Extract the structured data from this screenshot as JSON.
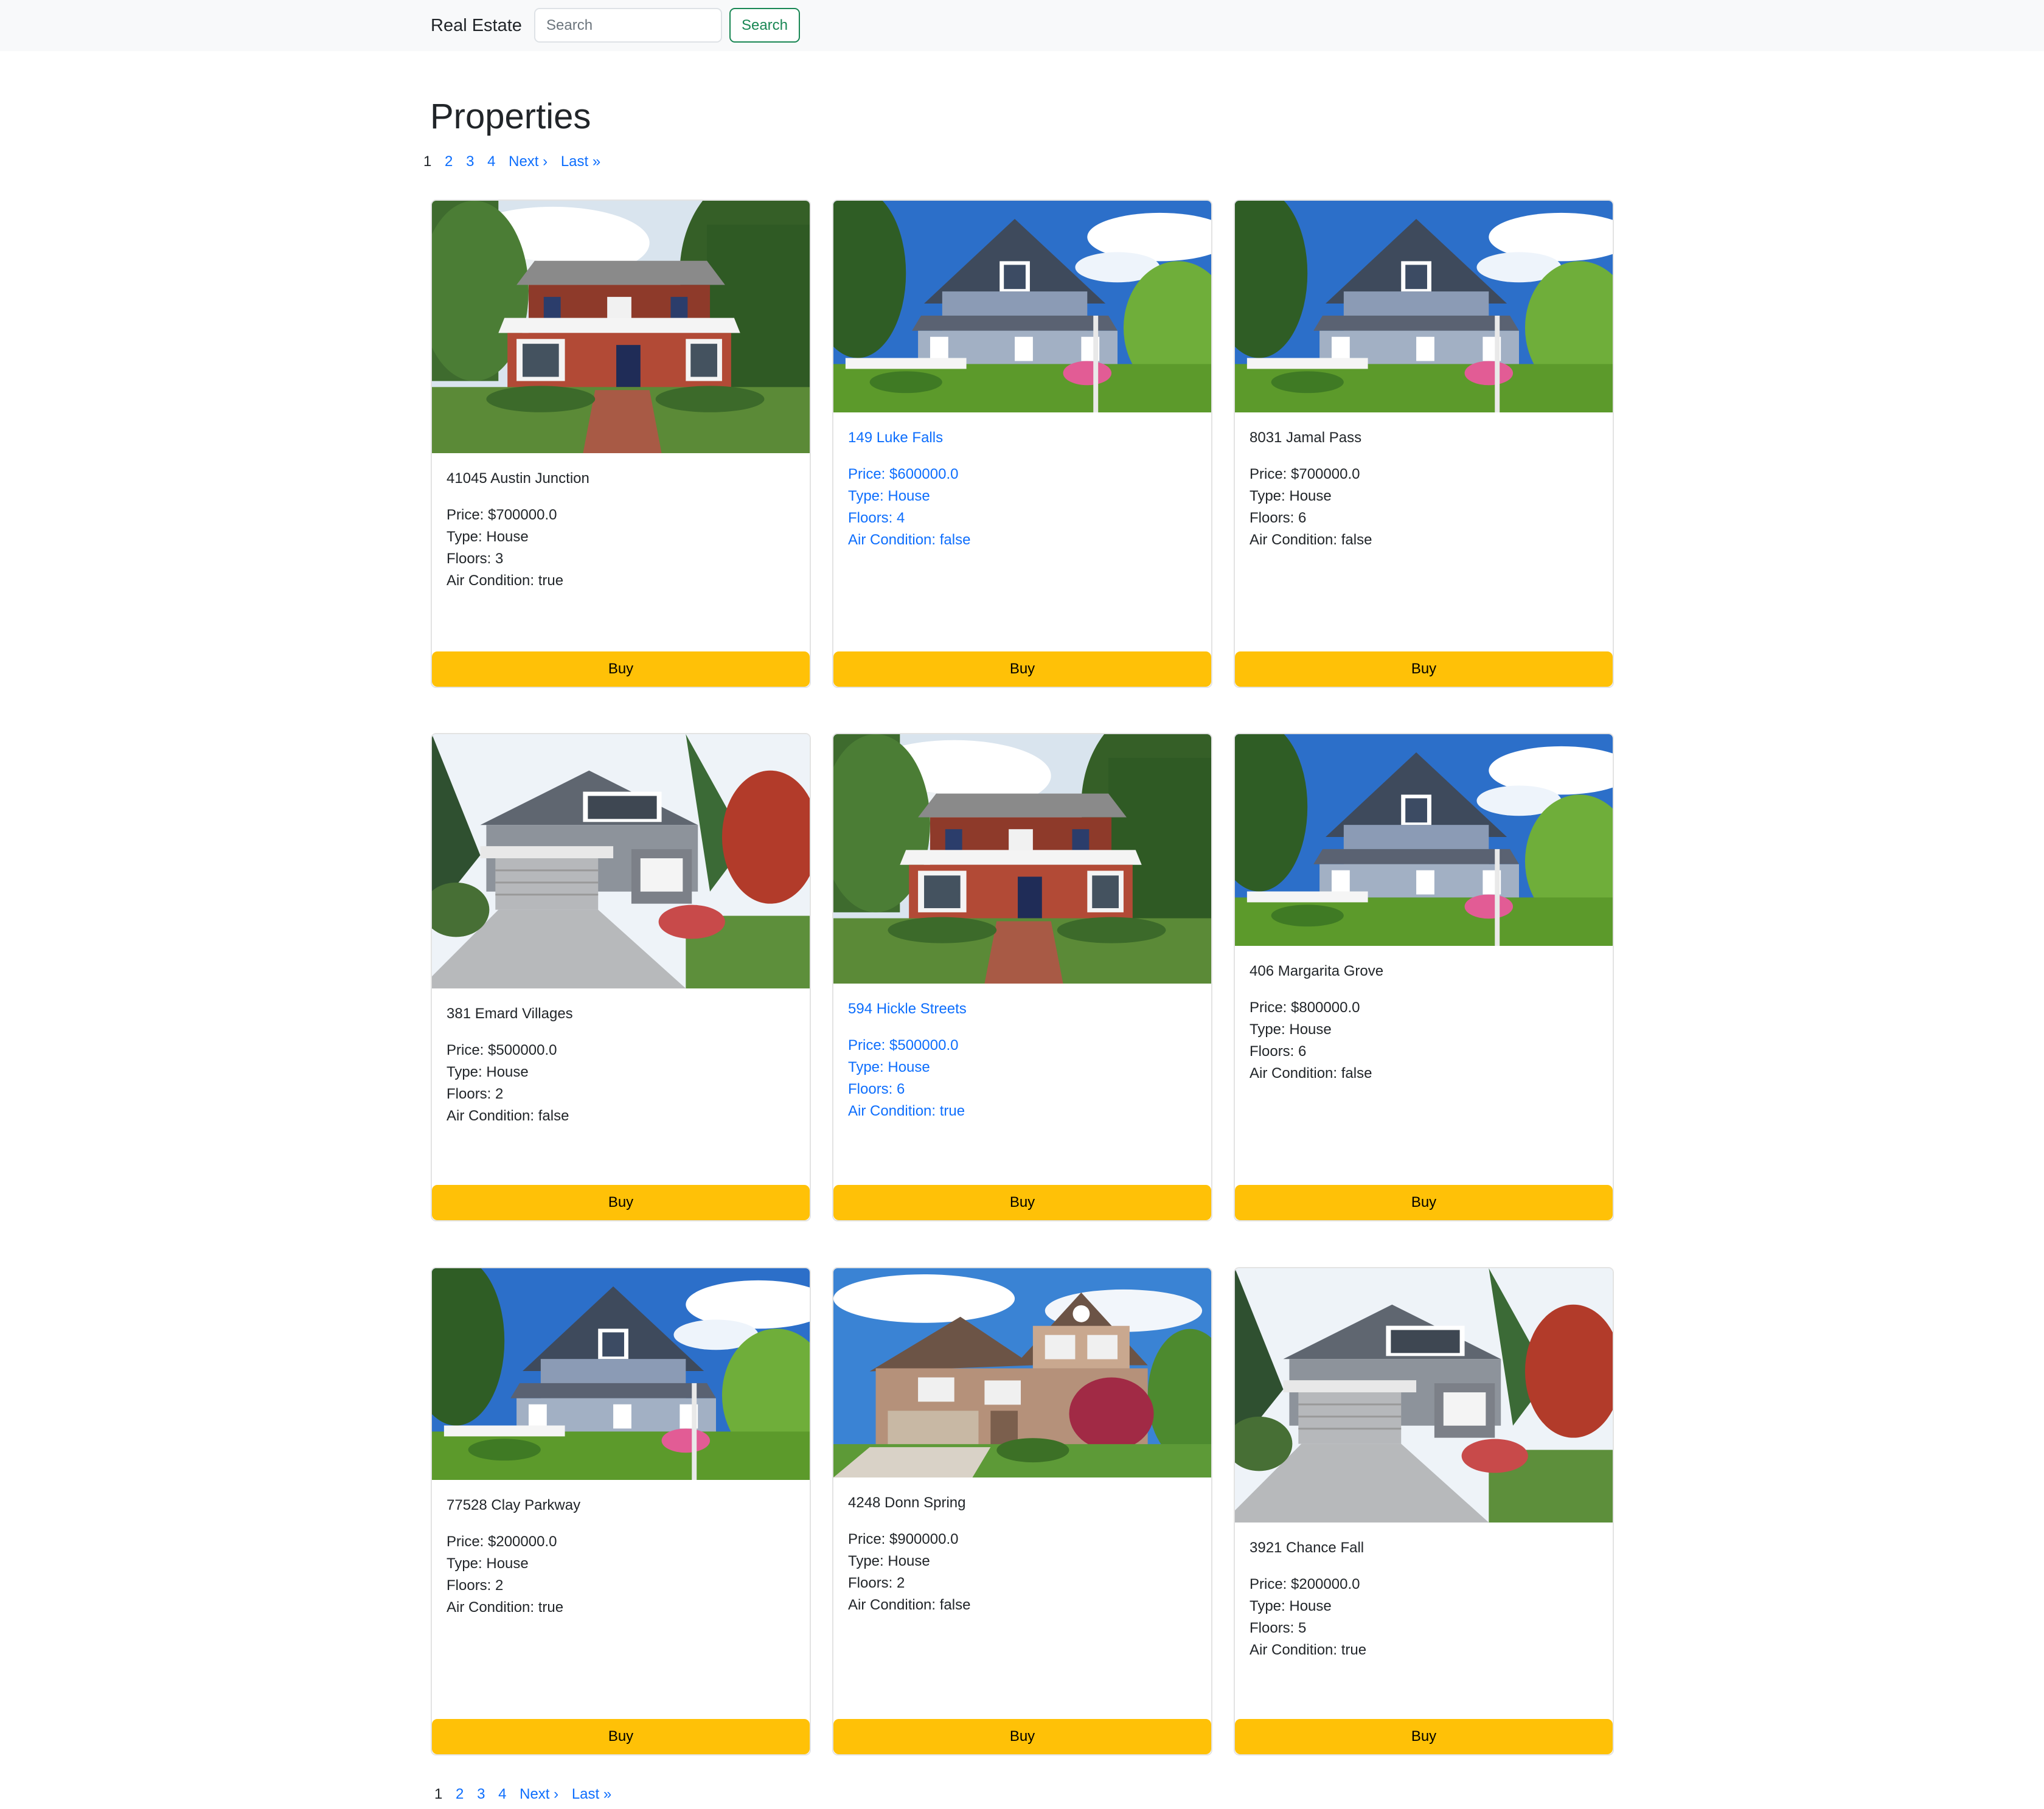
{
  "navbar": {
    "brand": "Real Estate",
    "search_placeholder": "Search",
    "search_button": "Search"
  },
  "page": {
    "title": "Properties"
  },
  "pagination": {
    "current": "1",
    "pages": [
      "2",
      "3",
      "4"
    ],
    "next": "Next ›",
    "last": "Last »"
  },
  "properties": [
    {
      "address": "41045 Austin Junction",
      "price": "Price: $700000.0",
      "type": "Type: House",
      "floors": "Floors: 3",
      "ac": "Air Condition: true",
      "buy": "Buy",
      "image": "red-brick-house"
    },
    {
      "address": "149 Luke Falls",
      "price": "Price: $600000.0",
      "type": "Type: House",
      "floors": "Floors: 4",
      "ac": "Air Condition: false",
      "buy": "Buy",
      "image": "blue-cottage"
    },
    {
      "address": "8031 Jamal Pass",
      "price": "Price: $700000.0",
      "type": "Type: House",
      "floors": "Floors: 6",
      "ac": "Air Condition: false",
      "buy": "Buy",
      "image": "blue-cottage"
    },
    {
      "address": "381 Emard Villages",
      "price": "Price: $500000.0",
      "type": "Type: House",
      "floors": "Floors: 2",
      "ac": "Air Condition: false",
      "buy": "Buy",
      "image": "garage-house"
    },
    {
      "address": "594 Hickle Streets",
      "price": "Price: $500000.0",
      "type": "Type: House",
      "floors": "Floors: 6",
      "ac": "Air Condition: true",
      "buy": "Buy",
      "image": "red-brick-house"
    },
    {
      "address": "406 Margarita Grove",
      "price": "Price: $800000.0",
      "type": "Type: House",
      "floors": "Floors: 6",
      "ac": "Air Condition: false",
      "buy": "Buy",
      "image": "blue-cottage"
    },
    {
      "address": "77528 Clay Parkway",
      "price": "Price: $200000.0",
      "type": "Type: House",
      "floors": "Floors: 2",
      "ac": "Air Condition: true",
      "buy": "Buy",
      "image": "blue-cottage"
    },
    {
      "address": "4248 Donn Spring",
      "price": "Price: $900000.0",
      "type": "Type: House",
      "floors": "Floors: 2",
      "ac": "Air Condition: false",
      "buy": "Buy",
      "image": "suburban-house"
    },
    {
      "address": "3921 Chance Fall",
      "price": "Price: $200000.0",
      "type": "Type: House",
      "floors": "Floors: 5",
      "ac": "Air Condition: true",
      "buy": "Buy",
      "image": "garage-house"
    }
  ]
}
